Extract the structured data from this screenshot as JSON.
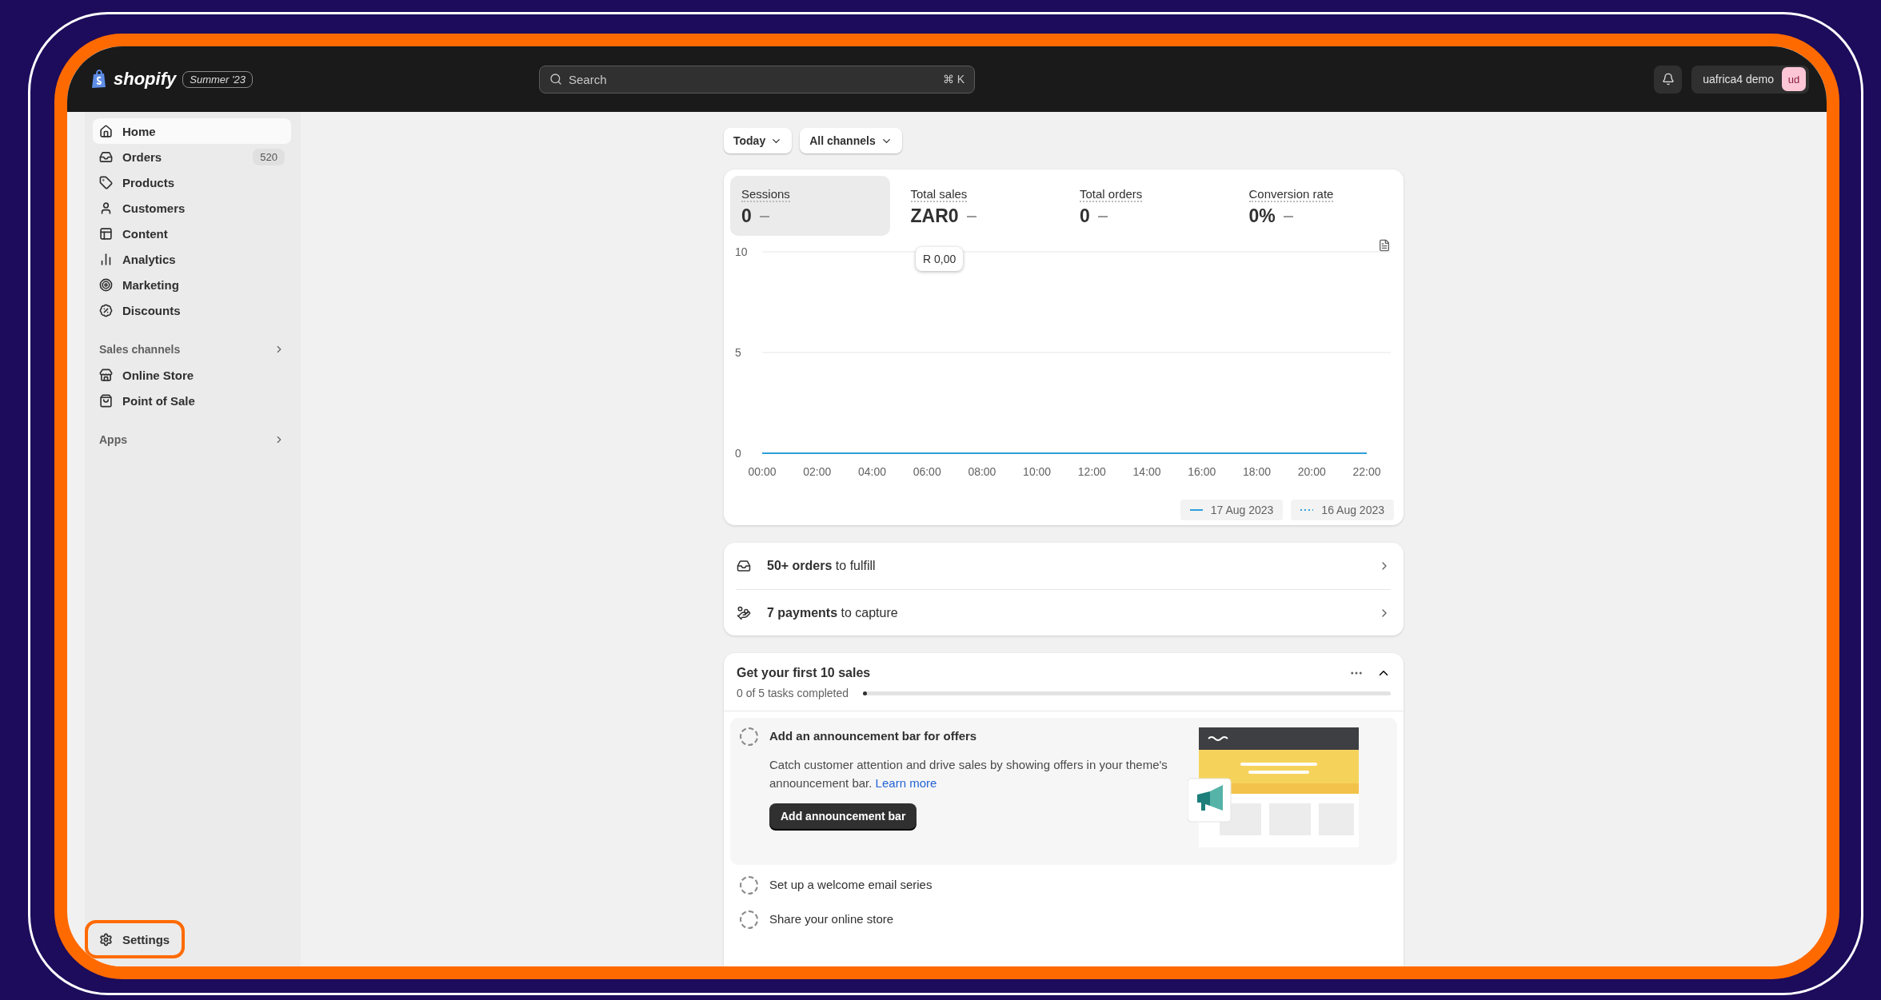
{
  "topbar": {
    "logo": "shopify",
    "edition": "Summer '23",
    "search": {
      "placeholder": "Search",
      "shortcut": "⌘ K"
    },
    "user": {
      "name": "uafrica4 demo",
      "initials": "ud"
    }
  },
  "sidebar": {
    "items": [
      {
        "label": "Home",
        "selected": true
      },
      {
        "label": "Orders",
        "selected": false,
        "count": "520"
      },
      {
        "label": "Products",
        "selected": false
      },
      {
        "label": "Customers",
        "selected": false
      },
      {
        "label": "Content",
        "selected": false
      },
      {
        "label": "Analytics",
        "selected": false
      },
      {
        "label": "Marketing",
        "selected": false
      },
      {
        "label": "Discounts",
        "selected": false
      }
    ],
    "sections": [
      {
        "title": "Sales channels",
        "items": [
          {
            "label": "Online Store",
            "selected": false
          },
          {
            "label": "Point of Sale",
            "selected": false
          }
        ]
      },
      {
        "title": "Apps"
      }
    ],
    "settings": {
      "label": "Settings",
      "highlighted": true
    }
  },
  "filters": [
    "Today",
    "All channels"
  ],
  "metrics": {
    "tiles": [
      {
        "label": "Sessions",
        "value": "0",
        "selected": true
      },
      {
        "label": "Total sales",
        "value": "ZAR0",
        "selected": false
      },
      {
        "label": "Total orders",
        "value": "0",
        "selected": false
      },
      {
        "label": "Conversion rate",
        "value": "0%",
        "selected": false
      }
    ],
    "tooltip": "R 0,00",
    "chart_data": {
      "type": "line",
      "x": [
        "00:00",
        "02:00",
        "04:00",
        "06:00",
        "08:00",
        "10:00",
        "12:00",
        "14:00",
        "16:00",
        "18:00",
        "20:00",
        "22:00"
      ],
      "ylim": [
        0,
        10
      ],
      "yticks": [
        0,
        5,
        10
      ],
      "series": [
        {
          "name": "17 Aug 2023",
          "color": "#2f9fdc",
          "line_style": "solid",
          "values": [
            0,
            0,
            0,
            0,
            0,
            0,
            0,
            0,
            0,
            0,
            0,
            0
          ]
        },
        {
          "name": "16 Aug 2023",
          "color": "#2f9fdc",
          "line_style": "dashed",
          "values": [
            0,
            0,
            0,
            0,
            0,
            0,
            0,
            0,
            0,
            0,
            0,
            0
          ]
        }
      ]
    }
  },
  "todo": [
    {
      "text": "**50+ orders** to fulfill"
    },
    {
      "text": "**7 payments** to capture"
    }
  ],
  "setup": {
    "title": "Get your first 10 sales",
    "progress_text": "0 of 5 tasks completed",
    "level": 0,
    "expanded": true,
    "tasks": [
      {
        "title": "Add an announcement bar for offers",
        "expanded": true,
        "description": "Catch customer attention and drive sales by showing offers in your theme's announcement bar.",
        "link": "Learn more",
        "button": "Add announcement bar"
      },
      {
        "title": "Set up a welcome email series",
        "expanded": false
      },
      {
        "title": "Share your online store",
        "expanded": false
      }
    ]
  }
}
